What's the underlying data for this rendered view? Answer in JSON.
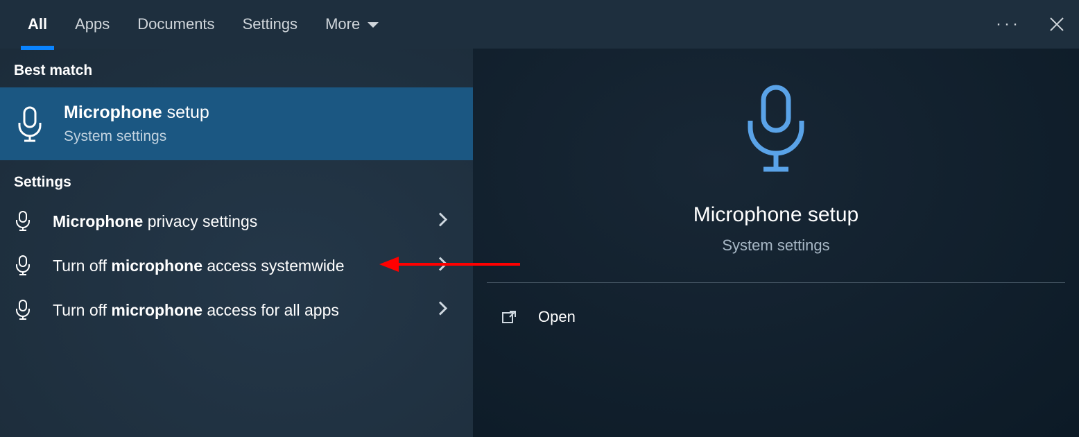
{
  "tabs": {
    "all": "All",
    "apps": "Apps",
    "documents": "Documents",
    "settings": "Settings",
    "more": "More"
  },
  "left": {
    "bestMatchHeader": "Best match",
    "best": {
      "titleBold": "Microphone",
      "titleRest": " setup",
      "sub": "System settings"
    },
    "settingsHeader": "Settings",
    "items": [
      {
        "pre": "",
        "bold": "Microphone",
        "post": " privacy settings"
      },
      {
        "pre": "Turn off ",
        "bold": "microphone",
        "post": " access systemwide"
      },
      {
        "pre": "Turn off ",
        "bold": "microphone",
        "post": " access for all apps"
      }
    ]
  },
  "right": {
    "title": "Microphone setup",
    "sub": "System settings",
    "open": "Open"
  }
}
